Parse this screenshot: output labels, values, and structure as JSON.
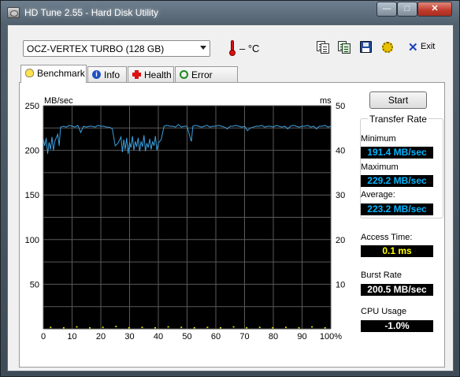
{
  "window": {
    "title": "HD Tune 2.55 - Hard Disk Utility",
    "min": "—",
    "max": "□",
    "close": "✕"
  },
  "toolbar": {
    "drive": "OCZ-VERTEX TURBO (128 GB)",
    "temperature": "– °C",
    "exit": "Exit",
    "icons": [
      "copy-icon",
      "copy-results-icon",
      "save-icon",
      "tools-icon",
      "exit-icon"
    ]
  },
  "tabs": [
    {
      "label": "Benchmark",
      "icon": "lightbulb-icon"
    },
    {
      "label": "Info",
      "icon": "info-icon"
    },
    {
      "label": "Health",
      "icon": "health-cross-icon"
    },
    {
      "label": "Error Scan",
      "icon": "magnifier-icon"
    }
  ],
  "controls": {
    "start": "Start"
  },
  "stats": {
    "transfer_rate_title": "Transfer Rate",
    "minimum_label": "Minimum",
    "minimum": "191.4 MB/sec",
    "maximum_label": "Maximum",
    "maximum": "229.2 MB/sec",
    "average_label": "Average:",
    "average": "223.2 MB/sec",
    "access_time_label": "Access Time:",
    "access_time": "0.1 ms",
    "burst_rate_label": "Burst Rate",
    "burst_rate": "200.5 MB/sec",
    "cpu_usage_label": "CPU Usage",
    "cpu_usage": "-1.0%"
  },
  "colors": {
    "plot_bg": "#000000",
    "grid": "#5a5a5a",
    "transfer_line": "#3aa0e0",
    "access_dots": "#ffff00",
    "value_cyan": "#00b4ff",
    "value_yellow": "#ffff00"
  },
  "chart_data": {
    "type": "line",
    "ylabel": "MB/sec",
    "y2label": "ms",
    "ylim": [
      0,
      250
    ],
    "y2lim": [
      0,
      50
    ],
    "xlim": [
      0,
      100
    ],
    "x_ticks": [
      "0",
      "10",
      "20",
      "30",
      "40",
      "50",
      "60",
      "70",
      "80",
      "90",
      "100%"
    ],
    "y_ticks": [
      "250",
      "200",
      "150",
      "100",
      "50"
    ],
    "y2_ticks": [
      "50",
      "40",
      "30",
      "20",
      "10"
    ],
    "grid": true,
    "series": [
      {
        "x": [
          0,
          0.5,
          1,
          1.5,
          2,
          2.5,
          3,
          3.5,
          4,
          4.5,
          5,
          5.5,
          6,
          7,
          8,
          9,
          10,
          11,
          12,
          13,
          14,
          15,
          16,
          17,
          18,
          19,
          20,
          21,
          22,
          23,
          24,
          25,
          26,
          27,
          27.5,
          28,
          28.5,
          29,
          29.5,
          30,
          30.5,
          31,
          31.5,
          32,
          32.5,
          33,
          33.5,
          34,
          34.5,
          35,
          35.5,
          36,
          36.5,
          37,
          37.5,
          38,
          38.5,
          39,
          39.5,
          40,
          41,
          42,
          43,
          44,
          45,
          46,
          47,
          48,
          49,
          50,
          51,
          51.5,
          52,
          53,
          54,
          55,
          56,
          57,
          58,
          59,
          60,
          61,
          62,
          63,
          64,
          65,
          66,
          67,
          68,
          69,
          70,
          71,
          72,
          73,
          74,
          75,
          76,
          77,
          78,
          79,
          80,
          81,
          82,
          83,
          84,
          85,
          86,
          87,
          88,
          89,
          90,
          91,
          92,
          93,
          94,
          95,
          96,
          97,
          98,
          99,
          100
        ],
        "values": [
          212,
          205,
          214,
          196,
          209,
          201,
          215,
          200,
          210,
          214,
          218,
          205,
          226,
          227,
          226,
          228,
          227,
          226,
          228,
          220,
          227,
          226,
          227,
          227,
          226,
          228,
          227,
          227,
          226,
          226,
          224,
          205,
          208,
          215,
          198,
          212,
          201,
          214,
          196,
          209,
          203,
          216,
          200,
          210,
          204,
          214,
          199,
          210,
          204,
          217,
          199,
          208,
          203,
          213,
          201,
          210,
          205,
          216,
          200,
          208,
          212,
          227,
          228,
          227,
          227,
          226,
          229,
          226,
          227,
          227,
          215,
          210,
          227,
          228,
          227,
          226,
          227,
          228,
          226,
          227,
          227,
          228,
          227,
          226,
          224,
          227,
          227,
          228,
          227,
          226,
          227,
          222,
          225,
          226,
          227,
          227,
          228,
          226,
          227,
          227,
          226,
          228,
          227,
          226,
          227,
          224,
          227,
          228,
          227,
          226,
          227,
          227,
          228,
          226,
          227,
          224,
          227,
          227,
          228,
          226,
          227
        ]
      }
    ],
    "access_time_ms": [
      0.3,
      0.2,
      0.4,
      0.2,
      0.3,
      0.5,
      0.2,
      0.3,
      0.2,
      0.4,
      0.3,
      0.2,
      0.3,
      0.2,
      0.4,
      0.2,
      0.3,
      0.2,
      0.3,
      0.2,
      0.4,
      0.2
    ]
  }
}
